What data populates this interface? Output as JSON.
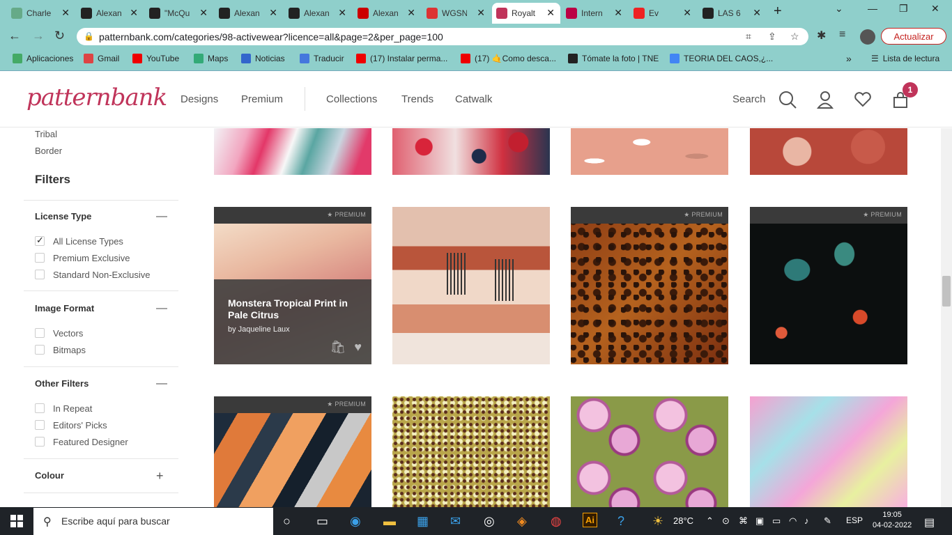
{
  "browser": {
    "tabs": [
      {
        "title": "Charle",
        "color": "#6a8"
      },
      {
        "title": "Alexan",
        "color": "#222"
      },
      {
        "title": "\"McQu",
        "color": "#222"
      },
      {
        "title": "Alexan",
        "color": "#222"
      },
      {
        "title": "Alexan",
        "color": "#222"
      },
      {
        "title": "Alexan",
        "color": "#c00"
      },
      {
        "title": "WGSN",
        "color": "#d33"
      },
      {
        "title": "Royalt",
        "color": "#c0345a",
        "active": true
      },
      {
        "title": "Intern",
        "color": "#b04"
      },
      {
        "title": "Ev",
        "color": "#e22"
      },
      {
        "title": "LAS 6",
        "color": "#222"
      }
    ],
    "url": "patternbank.com/categories/98-activewear?licence=all&page=2&per_page=100",
    "update_label": "Actualizar",
    "bookmarks": [
      {
        "label": "Aplicaciones",
        "color": "#4a6"
      },
      {
        "label": "Gmail",
        "color": "#d44"
      },
      {
        "label": "YouTube",
        "color": "#e00"
      },
      {
        "label": "Maps",
        "color": "#3a7"
      },
      {
        "label": "Noticias",
        "color": "#36c"
      },
      {
        "label": "Traducir",
        "color": "#47d"
      },
      {
        "label": "(17) Instalar perma...",
        "color": "#e00"
      },
      {
        "label": "(17) 🤙Como desca...",
        "color": "#e00"
      },
      {
        "label": "Tómate la foto | TNE",
        "color": "#222"
      },
      {
        "label": "TEORIA DEL CAOS,¿...",
        "color": "#4285f4"
      }
    ],
    "reading_list": "Lista de lectura"
  },
  "site": {
    "logo": "patternbank",
    "nav": [
      "Designs",
      "Premium",
      "Collections",
      "Trends",
      "Catwalk"
    ],
    "search_label": "Search",
    "cart_count": "1",
    "brand_color": "#c0345a"
  },
  "sidebar": {
    "categories": [
      "Tribal",
      "Border"
    ],
    "filters_title": "Filters",
    "groups": [
      {
        "title": "License Type",
        "toggle": "—",
        "options": [
          {
            "label": "All License Types",
            "checked": true
          },
          {
            "label": "Premium Exclusive",
            "checked": false
          },
          {
            "label": "Standard Non-Exclusive",
            "checked": false
          }
        ]
      },
      {
        "title": "Image Format",
        "toggle": "—",
        "options": [
          {
            "label": "Vectors",
            "checked": false
          },
          {
            "label": "Bitmaps",
            "checked": false
          }
        ]
      },
      {
        "title": "Other Filters",
        "toggle": "—",
        "options": [
          {
            "label": "In Repeat",
            "checked": false
          },
          {
            "label": "Editors' Picks",
            "checked": false
          },
          {
            "label": "Featured Designer",
            "checked": false
          }
        ]
      },
      {
        "title": "Colour",
        "toggle": "+",
        "options": []
      }
    ]
  },
  "grid": {
    "premium_label": "★ PREMIUM",
    "hover_title": "Monstera Tropical Print in Pale Citrus",
    "hover_author": "by Jaqueline Laux"
  },
  "taskbar": {
    "search_placeholder": "Escribe aquí para buscar",
    "weather": "28°C",
    "lang": "ESP",
    "time": "19:05",
    "date": "04-02-2022"
  }
}
